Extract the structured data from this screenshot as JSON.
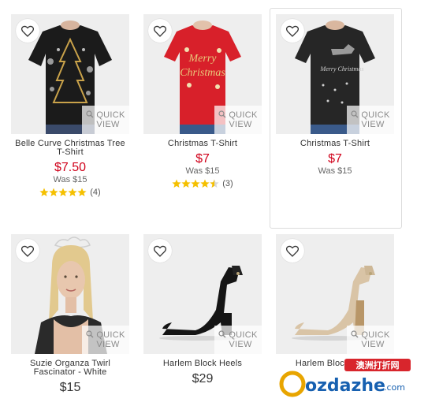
{
  "colors": {
    "sale": "#d0021b",
    "star": "#f5c000",
    "text": "#333333"
  },
  "products": [
    {
      "title_line1": "Belle Curve Christmas Tree",
      "title_line2": "T-Shirt",
      "price": "$7.50",
      "was": "Was $15",
      "rating": 5.0,
      "reviews": "(4)",
      "quick_view_1": "QUICK",
      "quick_view_2": "VIEW",
      "favourite_icon": "heart-outline-icon"
    },
    {
      "title_line1": "Christmas T-Shirt",
      "title_line2": "",
      "price": "$7",
      "was": "Was $15",
      "rating": 4.5,
      "reviews": "(3)",
      "quick_view_1": "QUICK",
      "quick_view_2": "VIEW",
      "favourite_icon": "heart-outline-icon"
    },
    {
      "title_line1": "Christmas T-Shirt",
      "title_line2": "",
      "price": "$7",
      "was": "Was $15",
      "quick_view_1": "QUICK",
      "quick_view_2": "VIEW",
      "favourite_icon": "heart-outline-icon"
    },
    {
      "title_line1": "Suzie Organza Twirl",
      "title_line2": "Fascinator - White",
      "price": "$15",
      "quick_view_1": "QUICK",
      "quick_view_2": "VIEW",
      "favourite_icon": "heart-outline-icon"
    },
    {
      "title_line1": "Harlem Block Heels",
      "title_line2": "",
      "price": "$29",
      "quick_view_1": "QUICK",
      "quick_view_2": "VIEW",
      "favourite_icon": "heart-outline-icon"
    },
    {
      "title_line1": "Harlem Block Heels",
      "title_line2": "",
      "price": "",
      "quick_view_1": "QUICK",
      "quick_view_2": "VIEW",
      "favourite_icon": "heart-outline-icon"
    }
  ],
  "watermark": {
    "brand": "ozdazhe",
    "suffix": ".com",
    "tagline": "澳洲打折网"
  }
}
